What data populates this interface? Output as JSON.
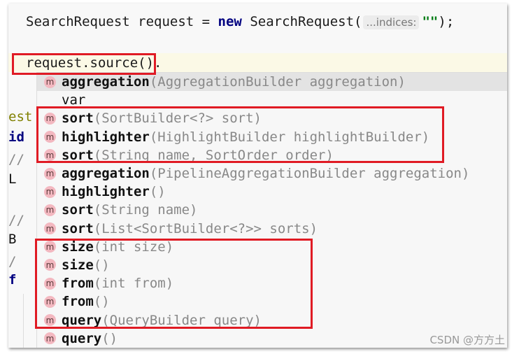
{
  "code": {
    "line1": {
      "type": "SearchRequest request = ",
      "kw": "new",
      "ctor": " SearchRequest(",
      "hint": "...indices:",
      "str": "\"\"",
      "end": ");"
    },
    "line2": {
      "text": "request.source()",
      "dot": "."
    },
    "gutter": [
      {
        "text": "est",
        "color": "#808000",
        "bold": false
      },
      {
        "text": "id",
        "color": "#000080",
        "bold": true
      },
      {
        "text": "//",
        "color": "#888",
        "bold": false
      },
      {
        "text": "L",
        "color": "#111",
        "bold": false
      },
      {
        "text": "//",
        "color": "#888",
        "bold": false
      },
      {
        "text": "B",
        "color": "#111",
        "bold": false
      },
      {
        "text": "/",
        "color": "#888",
        "bold": false
      },
      {
        "text": "f",
        "color": "#000080",
        "bold": true
      }
    ]
  },
  "completion": {
    "icon": "m",
    "items": [
      {
        "name": "aggregation",
        "params": "(AggregationBuilder aggregation)",
        "icon": true,
        "selected": true
      },
      {
        "name": "var",
        "params": "",
        "icon": false
      },
      {
        "name": "sort",
        "params": "(SortBuilder<?> sort)",
        "icon": true
      },
      {
        "name": "highlighter",
        "params": "(HighlightBuilder highlightBuilder)",
        "icon": true
      },
      {
        "name": "sort",
        "params": "(String name, SortOrder order)",
        "icon": true
      },
      {
        "name": "aggregation",
        "params": "(PipelineAggregationBuilder aggregation)",
        "icon": true
      },
      {
        "name": "highlighter",
        "params": "()",
        "icon": true
      },
      {
        "name": "sort",
        "params": "(String name)",
        "icon": true
      },
      {
        "name": "sort",
        "params": "(List<SortBuilder<?>> sorts)",
        "icon": true
      },
      {
        "name": "size",
        "params": "(int size)",
        "icon": true
      },
      {
        "name": "size",
        "params": "()",
        "icon": true
      },
      {
        "name": "from",
        "params": "(int from)",
        "icon": true
      },
      {
        "name": "from",
        "params": "()",
        "icon": true
      },
      {
        "name": "query",
        "params": "(QueryBuilder query)",
        "icon": true
      },
      {
        "name": "query",
        "params": "()",
        "icon": true
      }
    ]
  },
  "watermark": "CSDN @方方土",
  "colors": {
    "highlight_box": "#e01b24",
    "keyword": "#000080",
    "string": "#067d17"
  }
}
